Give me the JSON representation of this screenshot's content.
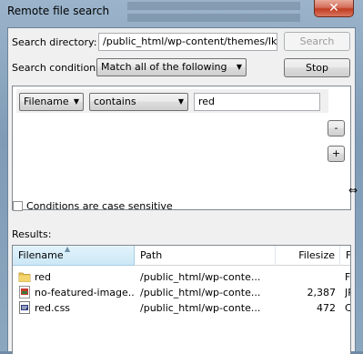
{
  "window": {
    "title": "Remote file search",
    "close_label": "✕"
  },
  "search": {
    "directory_label": "Search directory:",
    "directory_value": "/public_html/wp-content/themes/Ikarus\\",
    "search_button": "Search",
    "conditions_label": "Search conditions:",
    "conditions_value": "Match all of the following",
    "stop_button": "Stop"
  },
  "condition": {
    "field": "Filename",
    "operator": "contains",
    "value": "red",
    "remove_label": "-",
    "add_label": "+"
  },
  "case_sensitive": {
    "label": "Conditions are case sensitive",
    "checked": false
  },
  "results": {
    "label": "Results:",
    "columns": [
      "Filename",
      "Path",
      "Filesize",
      "Filetyp"
    ],
    "rows": [
      {
        "icon": "folder-icon",
        "name": "red",
        "path": "/public_html/wp-conte...",
        "size": "",
        "type": "File fo"
      },
      {
        "icon": "jpg-file-icon",
        "name": "no-featured-image....",
        "path": "/public_html/wp-conte...",
        "size": "2,387",
        "type": "JPG F"
      },
      {
        "icon": "css-file-icon",
        "name": "red.css",
        "path": "/public_html/wp-conte...",
        "size": "472",
        "type": "Casca"
      }
    ]
  },
  "colors": {
    "accent": "#3399ff",
    "close": "#c23d22",
    "window_frame": "#8ba6bf"
  }
}
